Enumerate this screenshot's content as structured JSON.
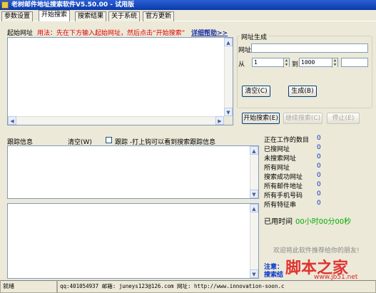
{
  "window": {
    "title": "老树邮件地址搜索软件V5.50.00 - 试用版"
  },
  "tabs": [
    {
      "label": "参数设置"
    },
    {
      "label": "开始搜索"
    },
    {
      "label": "搜索结果"
    },
    {
      "label": "关于系统"
    },
    {
      "label": "官方更新"
    }
  ],
  "start_url": {
    "label": "起始网址",
    "usage": "用法：先在下方输入起始网址，然后点击“开始搜索”",
    "help_link": "详细帮助>>"
  },
  "url_gen": {
    "group_title": "网址生成",
    "url_label": "网址",
    "url_value": "",
    "from_label": "从",
    "from_value": "1",
    "to_label": "到",
    "to_value": "1000",
    "extra_value": "",
    "clear_button": "清空(C)",
    "generate_button": "生成(B)"
  },
  "actions": {
    "start_button": "开始搜索(E)",
    "continue_button": "继续搜索(C)",
    "stop_button": "停止(E)"
  },
  "trace": {
    "label": "跟踪信息",
    "clear_link": "清空(W)",
    "checkbox_label": "跟踪 -打上钩可以看到搜索跟踪信息",
    "checked": false
  },
  "stats": {
    "items": [
      {
        "label": "正在工作的数目",
        "value": "0"
      },
      {
        "label": "已搜网址",
        "value": "0"
      },
      {
        "label": "未搜索网址",
        "value": "0"
      },
      {
        "label": "所有网址",
        "value": "0"
      },
      {
        "label": "搜索成功网址",
        "value": "0"
      },
      {
        "label": "所有邮件地址",
        "value": "0"
      },
      {
        "label": "所有手机号码",
        "value": "0"
      },
      {
        "label": "所有特征串",
        "value": "0"
      }
    ],
    "time_label": "已用时间",
    "time_value": "00小时00分00秒"
  },
  "promo": {
    "recommend": "欢迎将此软件推荐给你的朋友!",
    "notice_1": "注意：",
    "notice_2": "搜索结"
  },
  "watermark": {
    "logo": "脚本之家",
    "url": "www.jb51.net"
  },
  "statusbar": {
    "state": "就绪",
    "contact": "qq:401054937 邮箱: juneys123@126.com 网址: http://www.innovation-soon.c"
  },
  "colors": {
    "title_bar": "#0a3aa6",
    "usage_text": "#e00000",
    "help_link": "#1a2fa0",
    "stat_values": "#0033cc",
    "time_value": "#00aa00",
    "watermark": "#e02020"
  }
}
